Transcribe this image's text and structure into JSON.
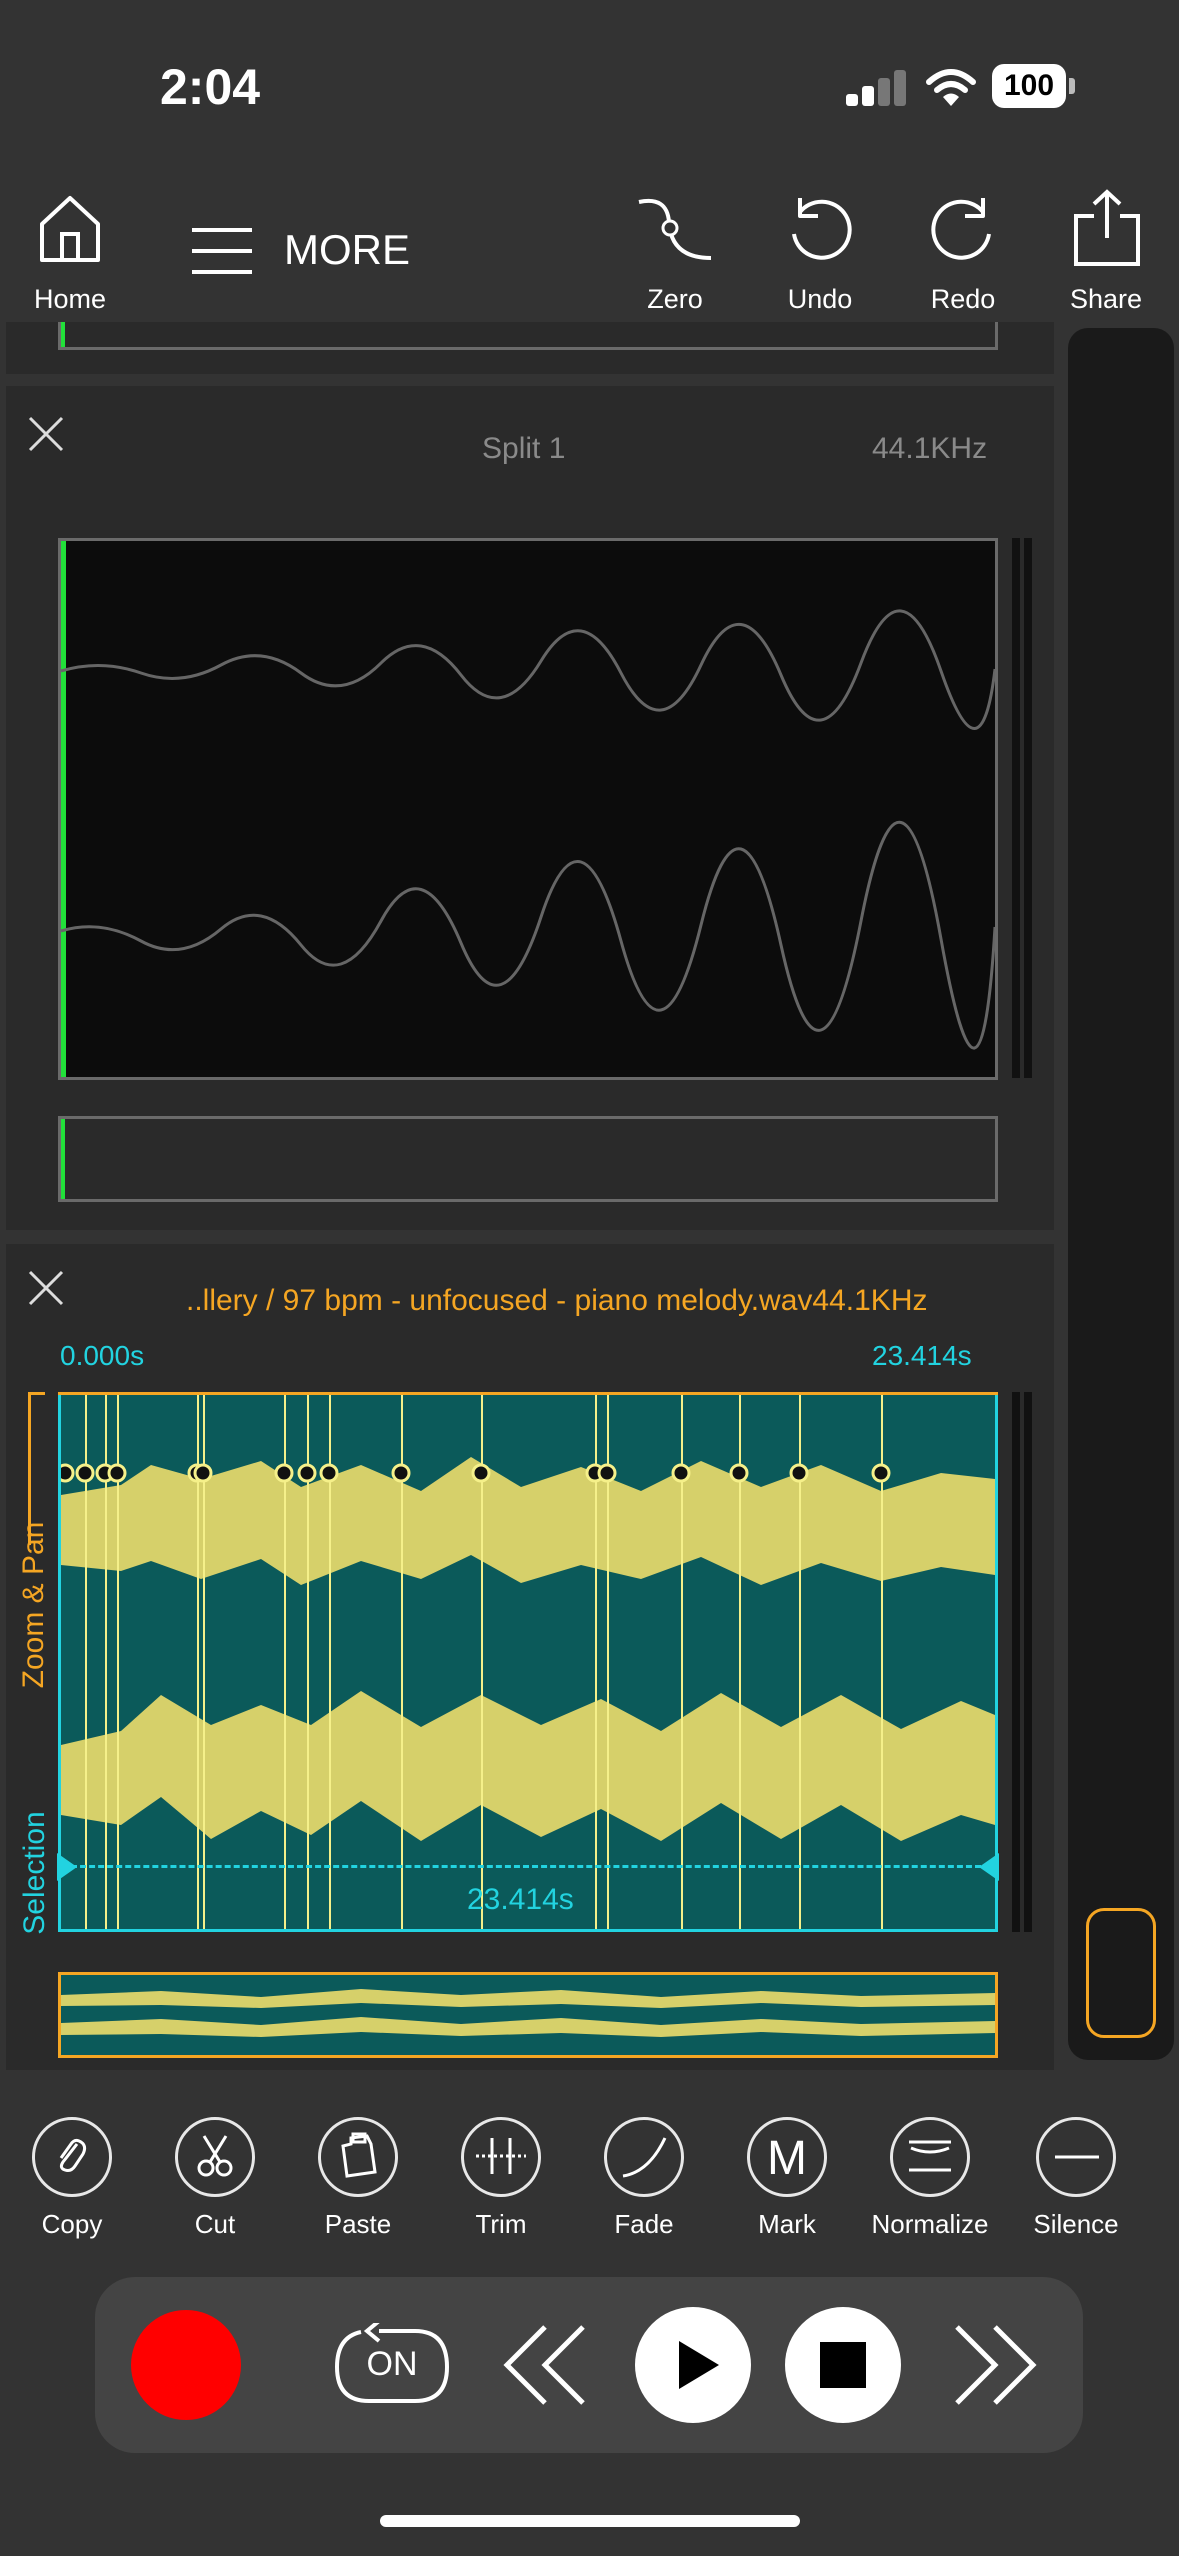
{
  "status": {
    "time": "2:04",
    "battery": "100"
  },
  "toolbar": {
    "home": "Home",
    "more": "MORE",
    "zero": "Zero",
    "undo": "Undo",
    "redo": "Redo",
    "share": "Share"
  },
  "panel_split": {
    "title": "Split 1",
    "sample_rate": "44.1KHz"
  },
  "panel_main": {
    "title": "..llery / 97 bpm - unfocused - piano melody.wav",
    "sample_rate": "44.1KHz",
    "start_time": "0.000s",
    "end_time": "23.414s",
    "selection_length": "23.414s",
    "side_label_zoom": "Zoom & Pan",
    "side_label_selection": "Selection"
  },
  "tools": [
    {
      "label": "Copy",
      "icon": "paperclip-icon"
    },
    {
      "label": "Cut",
      "icon": "scissors-icon"
    },
    {
      "label": "Paste",
      "icon": "paste-icon"
    },
    {
      "label": "Trim",
      "icon": "trim-icon"
    },
    {
      "label": "Fade",
      "icon": "fade-curve-icon"
    },
    {
      "label": "Mark",
      "icon": "mark-m-icon"
    },
    {
      "label": "Normalize",
      "icon": "normalize-icon"
    },
    {
      "label": "Silence",
      "icon": "silence-minus-icon"
    }
  ],
  "transport": {
    "loop_label": "ON"
  },
  "colors": {
    "accent_orange": "#f5a623",
    "accent_cyan": "#22d3e0",
    "wave_yellow": "#d6d06a",
    "wave_bg": "#0b5a5a",
    "record_red": "#ff0000",
    "playhead_green": "#22e03a"
  }
}
